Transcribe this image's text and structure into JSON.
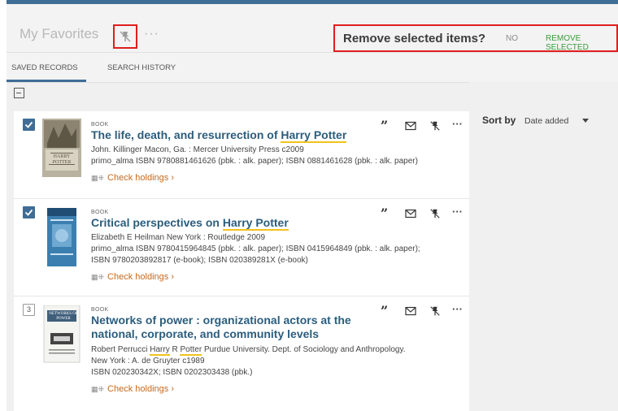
{
  "header": {
    "title": "My Favorites",
    "pin_icon": "unpin-icon",
    "more_label": "···"
  },
  "confirm": {
    "question": "Remove selected items?",
    "no_label": "NO",
    "remove_label": "REMOVE SELECTED"
  },
  "tabs": [
    {
      "label": "SAVED RECORDS",
      "active": true
    },
    {
      "label": "SEARCH HISTORY",
      "active": false
    }
  ],
  "records": [
    {
      "selected": true,
      "type": "BOOK",
      "title_pre": "The life, death, and resurrection of ",
      "title_hl": "Harry Potter",
      "title_post": "",
      "line1": "John. Killinger Macon, Ga. : Mercer University Press c2009",
      "line2": "primo_alma ISBN 9780881461626 (pbk. : alk. paper); ISBN 0881461628 (pbk. : alk. paper)",
      "line3": "",
      "line4": "",
      "holdings": "Check holdings",
      "cover_text": "HARRY POTTER"
    },
    {
      "selected": true,
      "type": "BOOK",
      "title_pre": "Critical perspectives on ",
      "title_hl": "Harry Potter",
      "title_post": "",
      "line1": "Elizabeth E Heilman New York : Routledge 2009",
      "line2": "primo_alma ISBN 9780415964845 (pbk. : alk. paper); ISBN 0415964849 (pbk. : alk. paper);",
      "line3": "ISBN 9780203892817 (e-book); ISBN 020389281X (e-book)",
      "line4": "",
      "holdings": "Check holdings"
    },
    {
      "selected": false,
      "number": "3",
      "type": "BOOK",
      "title_pre": "Networks of power : organizational actors at the national, corporate, and community levels",
      "title_hl": "",
      "title_post": "",
      "line1_pre": "Robert Perrucci ",
      "line1_hl1": "Harry",
      "line1_mid": " R ",
      "line1_hl2": "Potter",
      "line1_post": " Purdue University. Dept. of Sociology and Anthropology.",
      "line2": "New York : A. de Gruyter c1989",
      "line3": "ISBN 020230342X; ISBN 0202303438 (pbk.)",
      "holdings": "Check holdings",
      "cover_text": "NETWORKS OF POWER"
    }
  ],
  "record_actions": [
    "quote-icon",
    "email-icon",
    "unpin-icon",
    "more-icon"
  ],
  "sort": {
    "label": "Sort by",
    "value": "Date added"
  },
  "colors": {
    "accent": "#3f6d96",
    "title_link": "#2b5d7d",
    "holdings": "#c56a1e",
    "highlight": "#f2c21b",
    "confirm_green": "#3b9c3b",
    "callout_red": "#e01e1e"
  }
}
